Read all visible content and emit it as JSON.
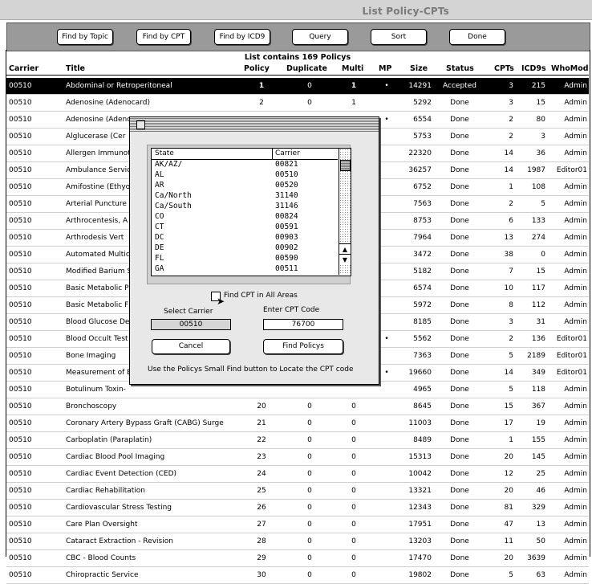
{
  "window": {
    "title": "List Policy-CPTs"
  },
  "toolbar": {
    "find_by_topic": "Find by Topic",
    "find_by_cpt": "Find by CPT",
    "find_by_icd9": "Find by ICD9",
    "query": "Query",
    "sort": "Sort",
    "done": "Done"
  },
  "list_info": "List contains 169 Policys",
  "columns": {
    "carrier": "Carrier",
    "title": "Title",
    "policy": "Policy",
    "duplicate": "Duplicate",
    "multi": "Multi",
    "mp": "MP",
    "size": "Size",
    "status": "Status",
    "cpts": "CPTs",
    "icd9s": "ICD9s",
    "whomod": "WhoMod"
  },
  "rows": [
    {
      "carrier": "00510",
      "title": "Abdominal or Retroperitoneal",
      "policy": "1",
      "duplicate": "0",
      "multi": "1",
      "mp": "•",
      "size": "14291",
      "status": "Accepted",
      "cpts": "3",
      "icd9s": "215",
      "whomod": "Admin"
    },
    {
      "carrier": "00510",
      "title": "Adenosine (Adenocard)",
      "policy": "2",
      "duplicate": "0",
      "multi": "1",
      "mp": "",
      "size": "5292",
      "status": "Done",
      "cpts": "3",
      "icd9s": "15",
      "whomod": "Admin"
    },
    {
      "carrier": "00510",
      "title": "Adenosine (Adeno",
      "policy": "",
      "duplicate": "",
      "multi": "",
      "mp": "•",
      "size": "6554",
      "status": "Done",
      "cpts": "2",
      "icd9s": "80",
      "whomod": "Admin"
    },
    {
      "carrier": "00510",
      "title": "Alglucerase (Cer",
      "policy": "",
      "duplicate": "",
      "multi": "",
      "mp": "",
      "size": "5753",
      "status": "Done",
      "cpts": "2",
      "icd9s": "3",
      "whomod": "Admin"
    },
    {
      "carrier": "00510",
      "title": "Allergen Immunot",
      "policy": "",
      "duplicate": "",
      "multi": "",
      "mp": "",
      "size": "22320",
      "status": "Done",
      "cpts": "14",
      "icd9s": "36",
      "whomod": "Admin"
    },
    {
      "carrier": "00510",
      "title": "Ambulance Servic",
      "policy": "",
      "duplicate": "",
      "multi": "",
      "mp": "",
      "size": "36257",
      "status": "Done",
      "cpts": "14",
      "icd9s": "1987",
      "whomod": "Editor01"
    },
    {
      "carrier": "00510",
      "title": "Amifostine (Ethyo",
      "policy": "",
      "duplicate": "",
      "multi": "",
      "mp": "",
      "size": "6752",
      "status": "Done",
      "cpts": "1",
      "icd9s": "108",
      "whomod": "Admin"
    },
    {
      "carrier": "00510",
      "title": "Arterial Puncture",
      "policy": "",
      "duplicate": "",
      "multi": "",
      "mp": "",
      "size": "7563",
      "status": "Done",
      "cpts": "2",
      "icd9s": "5",
      "whomod": "Admin"
    },
    {
      "carrier": "00510",
      "title": "Arthrocentesis, A",
      "policy": "",
      "duplicate": "",
      "multi": "",
      "mp": "",
      "size": "8753",
      "status": "Done",
      "cpts": "6",
      "icd9s": "133",
      "whomod": "Admin"
    },
    {
      "carrier": "00510",
      "title": "Arthrodesis Vert",
      "policy": "",
      "duplicate": "",
      "multi": "",
      "mp": "",
      "size": "7964",
      "status": "Done",
      "cpts": "13",
      "icd9s": "274",
      "whomod": "Admin"
    },
    {
      "carrier": "00510",
      "title": "Automated Multic",
      "policy": "",
      "duplicate": "",
      "multi": "",
      "mp": "",
      "size": "3472",
      "status": "Done",
      "cpts": "38",
      "icd9s": "0",
      "whomod": "Admin"
    },
    {
      "carrier": "00510",
      "title": "Modified Barium S",
      "policy": "",
      "duplicate": "",
      "multi": "",
      "mp": "",
      "size": "5182",
      "status": "Done",
      "cpts": "7",
      "icd9s": "15",
      "whomod": "Admin"
    },
    {
      "carrier": "00510",
      "title": "Basic Metabolic P",
      "policy": "",
      "duplicate": "",
      "multi": "",
      "mp": "",
      "size": "6574",
      "status": "Done",
      "cpts": "10",
      "icd9s": "117",
      "whomod": "Admin"
    },
    {
      "carrier": "00510",
      "title": "Basic Metabolic F",
      "policy": "",
      "duplicate": "",
      "multi": "",
      "mp": "",
      "size": "5972",
      "status": "Done",
      "cpts": "8",
      "icd9s": "112",
      "whomod": "Admin"
    },
    {
      "carrier": "00510",
      "title": "Blood Glucose Det",
      "policy": "",
      "duplicate": "",
      "multi": "",
      "mp": "",
      "size": "8185",
      "status": "Done",
      "cpts": "3",
      "icd9s": "31",
      "whomod": "Admin"
    },
    {
      "carrier": "00510",
      "title": "Blood Occult Test",
      "policy": "",
      "duplicate": "",
      "multi": "",
      "mp": "•",
      "size": "5562",
      "status": "Done",
      "cpts": "2",
      "icd9s": "136",
      "whomod": "Editor01"
    },
    {
      "carrier": "00510",
      "title": "Bone Imaging",
      "policy": "",
      "duplicate": "",
      "multi": "",
      "mp": "",
      "size": "7363",
      "status": "Done",
      "cpts": "5",
      "icd9s": "2189",
      "whomod": "Editor01"
    },
    {
      "carrier": "00510",
      "title": "Measurement of B",
      "policy": "",
      "duplicate": "",
      "multi": "",
      "mp": "•",
      "size": "19660",
      "status": "Done",
      "cpts": "14",
      "icd9s": "349",
      "whomod": "Editor01"
    },
    {
      "carrier": "00510",
      "title": "Botulinum Toxin-",
      "policy": "",
      "duplicate": "",
      "multi": "",
      "mp": "",
      "size": "4965",
      "status": "Done",
      "cpts": "5",
      "icd9s": "118",
      "whomod": "Admin"
    },
    {
      "carrier": "00510",
      "title": "Bronchoscopy",
      "policy": "20",
      "duplicate": "0",
      "multi": "0",
      "mp": "",
      "size": "8645",
      "status": "Done",
      "cpts": "15",
      "icd9s": "367",
      "whomod": "Admin"
    },
    {
      "carrier": "00510",
      "title": "Coronary Artery Bypass Graft (CABG) Surge",
      "policy": "21",
      "duplicate": "0",
      "multi": "0",
      "mp": "",
      "size": "11003",
      "status": "Done",
      "cpts": "17",
      "icd9s": "19",
      "whomod": "Admin"
    },
    {
      "carrier": "00510",
      "title": "Carboplatin (Paraplatin)",
      "policy": "22",
      "duplicate": "0",
      "multi": "0",
      "mp": "",
      "size": "8489",
      "status": "Done",
      "cpts": "1",
      "icd9s": "155",
      "whomod": "Admin"
    },
    {
      "carrier": "00510",
      "title": "Cardiac Blood Pool Imaging",
      "policy": "23",
      "duplicate": "0",
      "multi": "0",
      "mp": "",
      "size": "15313",
      "status": "Done",
      "cpts": "20",
      "icd9s": "145",
      "whomod": "Admin"
    },
    {
      "carrier": "00510",
      "title": "Cardiac Event Detection (CED)",
      "policy": "24",
      "duplicate": "0",
      "multi": "0",
      "mp": "",
      "size": "10042",
      "status": "Done",
      "cpts": "12",
      "icd9s": "25",
      "whomod": "Admin"
    },
    {
      "carrier": "00510",
      "title": "Cardiac Rehabilitation",
      "policy": "25",
      "duplicate": "0",
      "multi": "0",
      "mp": "",
      "size": "13321",
      "status": "Done",
      "cpts": "20",
      "icd9s": "46",
      "whomod": "Admin"
    },
    {
      "carrier": "00510",
      "title": "Cardiovascular Stress Testing",
      "policy": "26",
      "duplicate": "0",
      "multi": "0",
      "mp": "",
      "size": "12343",
      "status": "Done",
      "cpts": "81",
      "icd9s": "329",
      "whomod": "Admin"
    },
    {
      "carrier": "00510",
      "title": "Care Plan Oversight",
      "policy": "27",
      "duplicate": "0",
      "multi": "0",
      "mp": "",
      "size": "17951",
      "status": "Done",
      "cpts": "47",
      "icd9s": "13",
      "whomod": "Admin"
    },
    {
      "carrier": "00510",
      "title": "Cataract Extraction - Revision",
      "policy": "28",
      "duplicate": "0",
      "multi": "0",
      "mp": "",
      "size": "13203",
      "status": "Done",
      "cpts": "11",
      "icd9s": "50",
      "whomod": "Admin"
    },
    {
      "carrier": "00510",
      "title": "CBC - Blood Counts",
      "policy": "29",
      "duplicate": "0",
      "multi": "0",
      "mp": "",
      "size": "17470",
      "status": "Done",
      "cpts": "20",
      "icd9s": "3639",
      "whomod": "Admin"
    },
    {
      "carrier": "00510",
      "title": "Chiropractic Service",
      "policy": "30",
      "duplicate": "0",
      "multi": "0",
      "mp": "",
      "size": "19802",
      "status": "Done",
      "cpts": "5",
      "icd9s": "63",
      "whomod": "Admin"
    }
  ],
  "dialog": {
    "list_headers": {
      "state": "State",
      "carrier": "Carrier"
    },
    "states": [
      {
        "state": "AK/AZ/",
        "carrier": "00821"
      },
      {
        "state": "AL",
        "carrier": "00510"
      },
      {
        "state": "AR",
        "carrier": "00520"
      },
      {
        "state": "Ca/North",
        "carrier": "31140"
      },
      {
        "state": "Ca/South",
        "carrier": "31146"
      },
      {
        "state": "CO",
        "carrier": "00824"
      },
      {
        "state": "CT",
        "carrier": "00591"
      },
      {
        "state": "DC",
        "carrier": "00903"
      },
      {
        "state": "DE",
        "carrier": "00902"
      },
      {
        "state": "FL",
        "carrier": "00590"
      },
      {
        "state": "GA",
        "carrier": "00511"
      }
    ],
    "find_all_label": "Find CPT in All Areas",
    "select_carrier_label": "Select Carrier",
    "select_carrier_value": "00510",
    "enter_cpt_label": "Enter CPT Code",
    "enter_cpt_value": "76700",
    "cancel": "Cancel",
    "find_policys": "Find Policys",
    "hint": "Use the Policys Small Find button to Locate the CPT code"
  }
}
